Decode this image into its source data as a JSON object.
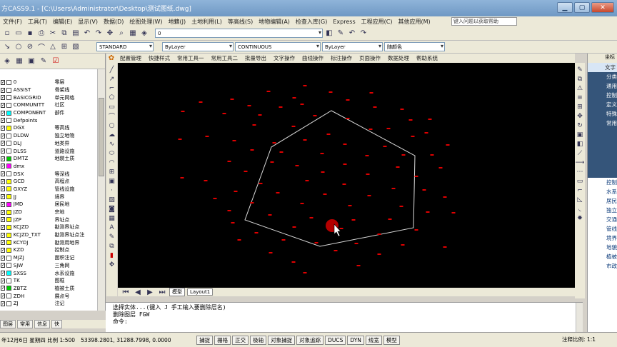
{
  "app": {
    "title": "方CASS9.1 - [C:\\Users\\Administrator\\Desktop\\测试图纸.dwg]"
  },
  "menubar": {
    "items": [
      "文件(F)",
      "工具(T)",
      "编辑(E)",
      "显示(V)",
      "数据(D)",
      "绘图处理(W)",
      "地籍(J)",
      "土地利用(L)",
      "等高线(S)",
      "地物编辑(A)",
      "检查入库(G)",
      "Express",
      "工程应用(C)",
      "其他应用(M)"
    ],
    "help_search": "键入问题以获取帮助"
  },
  "toolbar2": {
    "text_style": "STANDARD",
    "color": "ByLayer",
    "linetype": "CONTINUOUS",
    "lineweight": "ByLayer",
    "plotstyle": "随颜色",
    "layer": "0"
  },
  "cass_menu": [
    "配置管理",
    "快捷样式",
    "常用工具一",
    "常用工具二",
    "批量导出",
    "文字操作",
    "曲线操作",
    "标注操作",
    "页面操作",
    "数据处理",
    "帮助系统"
  ],
  "layers": [
    {
      "name": "0",
      "desc": "零层",
      "color": "#ffffff"
    },
    {
      "name": "ASSIST",
      "desc": "骨架线",
      "color": "#ffffff"
    },
    {
      "name": "BASICGRID",
      "desc": "单元网格",
      "color": "#ffffff"
    },
    {
      "name": "COMMUNITT",
      "desc": "社区",
      "color": "#ffffff"
    },
    {
      "name": "COMPONENT",
      "desc": "部件",
      "color": "#00ffff"
    },
    {
      "name": "Defpoints",
      "desc": "",
      "color": "#ffffff"
    },
    {
      "name": "DGX",
      "desc": "等高线",
      "color": "#ffff00"
    },
    {
      "name": "DLDW",
      "desc": "独立地物",
      "color": "#ffffff"
    },
    {
      "name": "DLJ",
      "desc": "地类界",
      "color": "#ffffff"
    },
    {
      "name": "DLSS",
      "desc": "道路设施",
      "color": "#ffffff"
    },
    {
      "name": "DMTZ",
      "desc": "地貌土质",
      "color": "#00cc00"
    },
    {
      "name": "dmx",
      "desc": "",
      "color": "#ff00ff"
    },
    {
      "name": "DSX",
      "desc": "等深线",
      "color": "#ffffff"
    },
    {
      "name": "GCD",
      "desc": "高程点",
      "color": "#ffff00"
    },
    {
      "name": "GXYZ",
      "desc": "管线设施",
      "color": "#ffff00"
    },
    {
      "name": "JJ",
      "desc": "境界",
      "color": "#ffff00"
    },
    {
      "name": "JMD",
      "desc": "居民地",
      "color": "#ff00ff"
    },
    {
      "name": "JZD",
      "desc": "宗地",
      "color": "#ffff00"
    },
    {
      "name": "JZP",
      "desc": "界址点",
      "color": "#ffff00"
    },
    {
      "name": "KCJZD",
      "desc": "勘测界址点",
      "color": "#ffff00"
    },
    {
      "name": "KCJZD_TXT",
      "desc": "勘测界址点注",
      "color": "#ffff00"
    },
    {
      "name": "KCYDJ",
      "desc": "勘测用地界",
      "color": "#ffff00"
    },
    {
      "name": "KZD",
      "desc": "控制点",
      "color": "#ffff00"
    },
    {
      "name": "MJZJ",
      "desc": "面积注记",
      "color": "#ffffff"
    },
    {
      "name": "SJW",
      "desc": "三角网",
      "color": "#ffffff"
    },
    {
      "name": "SXSS",
      "desc": "水系设施",
      "color": "#00ffff"
    },
    {
      "name": "TK",
      "desc": "图框",
      "color": "#ffffff"
    },
    {
      "name": "ZBTZ",
      "desc": "植被土质",
      "color": "#00cc00"
    },
    {
      "name": "ZDH",
      "desc": "展点号",
      "color": "#ffffff"
    },
    {
      "name": "ZJ",
      "desc": "注记",
      "color": "#ffffff"
    }
  ],
  "left_tabs": [
    "图层",
    "常用",
    "信息",
    "快"
  ],
  "model_tabs": [
    "模型",
    "Layout1"
  ],
  "command": {
    "line1": "选择实体...(键入 J 手工输入要删除层名)",
    "line2": "删除图层 FGW",
    "prompt": "命令:"
  },
  "right_panel": {
    "header": "坐标",
    "items": [
      "文字",
      "分类",
      "通用",
      "控制",
      "定义",
      "特殊",
      "常用",
      "控制",
      "水系",
      "居民",
      "独立",
      "交通",
      "管线",
      "境界",
      "地貌",
      "植被",
      "市政"
    ]
  },
  "statusbar": {
    "date": "年12月6日 星期四 比例 1:500",
    "coords": "53398.2801, 31288.7998, 0.0000",
    "buttons": [
      "捕捉",
      "栅格",
      "正交",
      "极轴",
      "对象捕捉",
      "对象追踪",
      "DUCS",
      "DYN",
      "线宽",
      "模型"
    ],
    "annotation_scale": "注释比例: 1:1"
  },
  "chart_data": {
    "type": "scatter",
    "xlim": [
      0,
      640
    ],
    "ylim": [
      0,
      315
    ],
    "points": [
      [
        262,
        32
      ],
      [
        211,
        40
      ],
      [
        298,
        41
      ],
      [
        355,
        42
      ],
      [
        160,
        51
      ],
      [
        247,
        49
      ],
      [
        322,
        52
      ],
      [
        116,
        55
      ],
      [
        184,
        60
      ],
      [
        228,
        62
      ],
      [
        258,
        58
      ],
      [
        360,
        62
      ],
      [
        398,
        65
      ],
      [
        91,
        68
      ],
      [
        149,
        71
      ],
      [
        199,
        73
      ],
      [
        276,
        74
      ],
      [
        322,
        78
      ],
      [
        410,
        80
      ],
      [
        437,
        79
      ],
      [
        191,
        87
      ],
      [
        246,
        89
      ],
      [
        354,
        93
      ],
      [
        379,
        92
      ],
      [
        432,
        98
      ],
      [
        125,
        103
      ],
      [
        295,
        100
      ],
      [
        413,
        103
      ],
      [
        87,
        107
      ],
      [
        163,
        109
      ],
      [
        219,
        112
      ],
      [
        262,
        108
      ],
      [
        318,
        114
      ],
      [
        374,
        117
      ],
      [
        462,
        115
      ],
      [
        188,
        122
      ],
      [
        229,
        125
      ],
      [
        286,
        127
      ],
      [
        349,
        130
      ],
      [
        400,
        129
      ],
      [
        440,
        129
      ],
      [
        156,
        138
      ],
      [
        216,
        139
      ],
      [
        318,
        142
      ],
      [
        251,
        144
      ],
      [
        392,
        146
      ],
      [
        452,
        147
      ],
      [
        179,
        152
      ],
      [
        287,
        153
      ],
      [
        350,
        156
      ],
      [
        418,
        159
      ],
      [
        90,
        161
      ],
      [
        123,
        165
      ],
      [
        265,
        165
      ],
      [
        200,
        169
      ],
      [
        317,
        170
      ],
      [
        386,
        176
      ],
      [
        429,
        178
      ],
      [
        165,
        180
      ],
      [
        224,
        182
      ],
      [
        290,
        184
      ],
      [
        352,
        186
      ],
      [
        458,
        188
      ],
      [
        136,
        190
      ],
      [
        188,
        196
      ],
      [
        258,
        197
      ],
      [
        325,
        200
      ],
      [
        397,
        201
      ],
      [
        156,
        207
      ],
      [
        434,
        209
      ],
      [
        470,
        210
      ],
      [
        213,
        213
      ],
      [
        271,
        217
      ],
      [
        330,
        220
      ],
      [
        381,
        219
      ],
      [
        161,
        224
      ],
      [
        247,
        230
      ],
      [
        313,
        232
      ],
      [
        418,
        234
      ],
      [
        194,
        238
      ],
      [
        366,
        240
      ],
      [
        170,
        248
      ],
      [
        232,
        248
      ],
      [
        278,
        252
      ],
      [
        334,
        253
      ],
      [
        399,
        255
      ],
      [
        458,
        258
      ],
      [
        214,
        266
      ],
      [
        305,
        263
      ],
      [
        366,
        268
      ],
      [
        246,
        279
      ],
      [
        337,
        284
      ],
      [
        262,
        294
      ]
    ],
    "polygon": [
      [
        299,
        67
      ],
      [
        416,
        130
      ],
      [
        414,
        231
      ],
      [
        283,
        257
      ],
      [
        178,
        220
      ],
      [
        215,
        118
      ]
    ]
  }
}
